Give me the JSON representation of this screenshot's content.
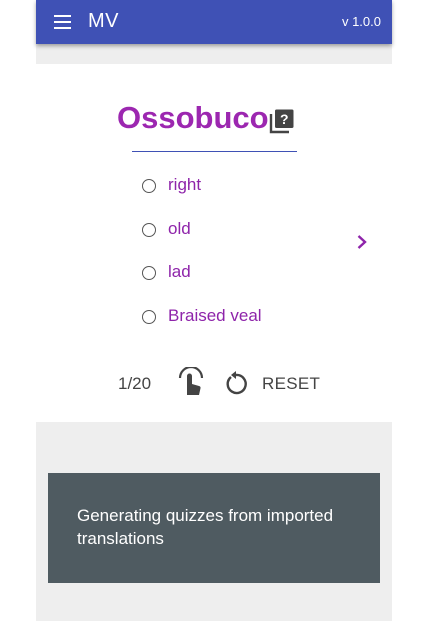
{
  "appbar": {
    "title": "MV",
    "version": "v 1.0.0"
  },
  "quiz": {
    "word": "Ossobuco",
    "options": [
      {
        "label": "right"
      },
      {
        "label": "old"
      },
      {
        "label": "lad"
      },
      {
        "label": "Braised veal"
      }
    ],
    "progress": "1/20",
    "reset_label": "RESET"
  },
  "snackbar": {
    "message": "Generating quizzes from imported translations"
  },
  "colors": {
    "appbar": "#3f51b5",
    "accent": "#9c27b0",
    "snackbar": "#4f5b61"
  },
  "icons": {
    "menu": "menu-icon",
    "quiz": "quiz-icon",
    "next": "chevron-right-icon",
    "tap": "touch-app-icon",
    "reset": "reset-icon"
  }
}
